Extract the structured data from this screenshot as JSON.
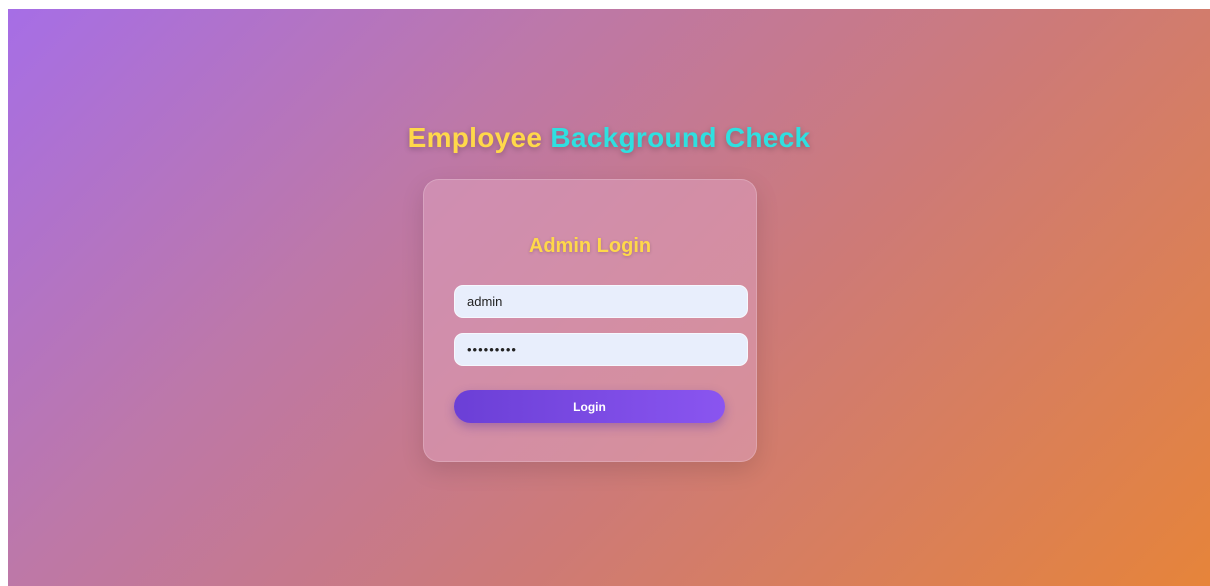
{
  "header": {
    "title_part1": "Employee",
    "title_part2": "Background Check"
  },
  "login_card": {
    "title": "Admin Login",
    "username_value": "admin",
    "password_value": "•••••••••",
    "login_button_label": "Login"
  },
  "colors": {
    "title_part1": "#ffd84a",
    "title_part2": "#2fe0e0",
    "card_title": "#ffd84a",
    "button_start": "#6b3fd6",
    "button_end": "#8a55f0",
    "input_background": "#e8eefc"
  }
}
